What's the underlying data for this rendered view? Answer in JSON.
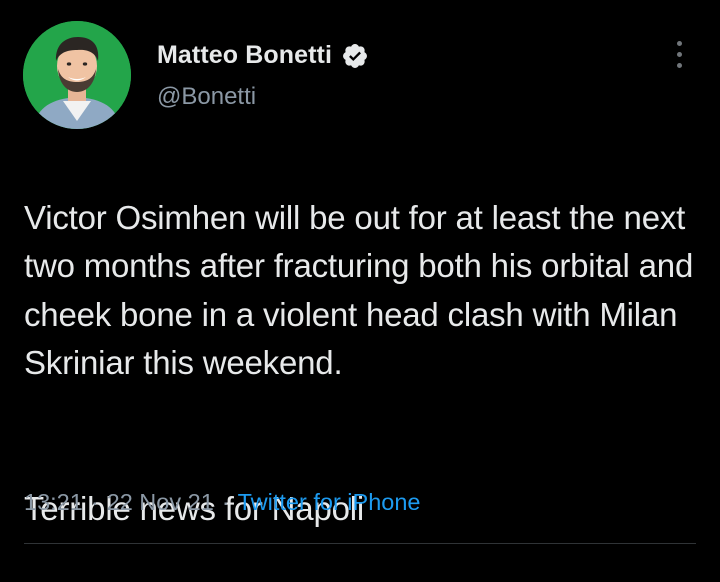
{
  "author": {
    "display_name": "Matteo Bonetti",
    "handle": "@Bonetti",
    "verified": true,
    "avatar_background": "#23a54a"
  },
  "tweet": {
    "text": "Victor Osimhen will be out for at least the next two months after fracturing both his orbital and cheek bone in a violent head clash with Milan Skriniar this weekend.",
    "text_second": "Terrible news for Napoli"
  },
  "meta": {
    "time": "13:21",
    "separator": "·",
    "date": "22 Nov 21",
    "source": "Twitter for iPhone"
  },
  "icons": {
    "verified": "verified-badge-icon",
    "more": "more-options-icon"
  },
  "colors": {
    "background": "#000000",
    "primary_text": "#e7e9ea",
    "secondary_text": "#8b98a5",
    "link": "#1d9bf0"
  }
}
